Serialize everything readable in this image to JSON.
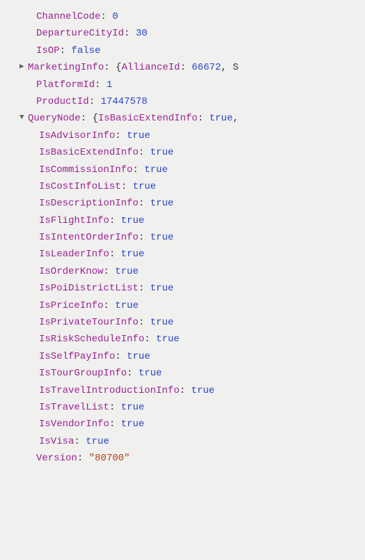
{
  "root": {
    "ChannelCode": {
      "key": "ChannelCode",
      "value": "0",
      "type": "num"
    },
    "DepartureCityId": {
      "key": "DepartureCityId",
      "value": "30",
      "type": "num"
    },
    "IsOP": {
      "key": "IsOP",
      "value": "false",
      "type": "bool"
    },
    "MarketingInfo": {
      "key": "MarketingInfo",
      "brace": "{",
      "previewKey": "AllianceId",
      "previewColon": ": ",
      "previewVal": "66672",
      "previewTrail": ", S"
    },
    "PlatformId": {
      "key": "PlatformId",
      "value": "1",
      "type": "num"
    },
    "ProductId": {
      "key": "ProductId",
      "value": "17447578",
      "type": "num"
    },
    "QueryNode": {
      "key": "QueryNode",
      "brace": "{",
      "previewKey": "IsBasicExtendInfo",
      "previewColon": ": ",
      "previewVal": "true",
      "previewTrail": ","
    },
    "Version": {
      "key": "Version",
      "value": "\"80700\"",
      "type": "str"
    }
  },
  "querynode_children": [
    {
      "key": "IsAdvisorInfo",
      "value": "true"
    },
    {
      "key": "IsBasicExtendInfo",
      "value": "true"
    },
    {
      "key": "IsCommissionInfo",
      "value": "true"
    },
    {
      "key": "IsCostInfoList",
      "value": "true"
    },
    {
      "key": "IsDescriptionInfo",
      "value": "true"
    },
    {
      "key": "IsFlightInfo",
      "value": "true"
    },
    {
      "key": "IsIntentOrderInfo",
      "value": "true"
    },
    {
      "key": "IsLeaderInfo",
      "value": "true"
    },
    {
      "key": "IsOrderKnow",
      "value": "true"
    },
    {
      "key": "IsPoiDistrictList",
      "value": "true"
    },
    {
      "key": "IsPriceInfo",
      "value": "true"
    },
    {
      "key": "IsPrivateTourInfo",
      "value": "true"
    },
    {
      "key": "IsRiskScheduleInfo",
      "value": "true"
    },
    {
      "key": "IsSelfPayInfo",
      "value": "true"
    },
    {
      "key": "IsTourGroupInfo",
      "value": "true"
    },
    {
      "key": "IsTravelIntroductionInfo",
      "value": "true"
    },
    {
      "key": "IsTravelList",
      "value": "true"
    },
    {
      "key": "IsVendorInfo",
      "value": "true"
    },
    {
      "key": "IsVisa",
      "value": "true"
    }
  ],
  "glyphs": {
    "collapsed": "▶",
    "expanded": "▼"
  }
}
